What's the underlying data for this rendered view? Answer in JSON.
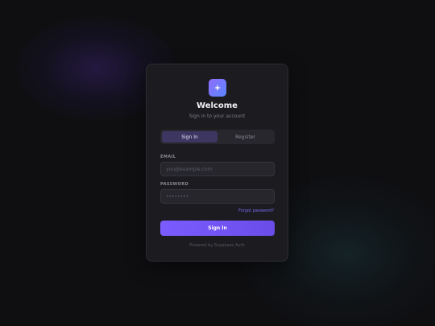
{
  "colors": {
    "background": "#0f0f12",
    "card": "#1c1c20",
    "accent": "#7a5cff",
    "link": "#7b6cff"
  },
  "header": {
    "logo_icon": "sparkle-icon",
    "title": "Welcome",
    "subtitle": "Sign in to your account"
  },
  "tabs": [
    {
      "label": "Sign In",
      "active": true
    },
    {
      "label": "Register",
      "active": false
    }
  ],
  "form": {
    "email": {
      "label": "EMAIL",
      "value": "",
      "placeholder": "you@example.com"
    },
    "password": {
      "label": "PASSWORD",
      "value": "",
      "placeholder": "••••••••"
    },
    "forgot_label": "Forgot password?",
    "submit_label": "Sign In"
  },
  "footer": {
    "text": "Powered by Supabase Auth"
  }
}
